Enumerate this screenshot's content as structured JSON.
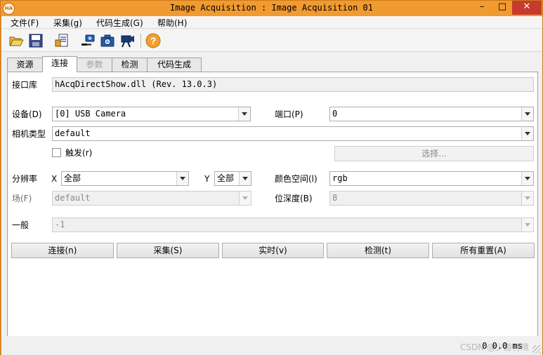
{
  "window": {
    "app_icon_text": "HA",
    "title": "Image Acquisition : Image Acquisition 01",
    "minimize": "–",
    "maximize": "□",
    "close": "✕"
  },
  "menu": [
    "文件(F)",
    "采集(g)",
    "代码生成(G)",
    "帮助(H)"
  ],
  "toolbar": {
    "icons": [
      "open-folder-icon",
      "save-icon",
      "generate-code-icon",
      "connect-camera-icon",
      "snap-camera-icon",
      "live-camera-icon",
      "help-icon"
    ]
  },
  "tabs": [
    {
      "label": "资源",
      "state": "normal"
    },
    {
      "label": "连接",
      "state": "active"
    },
    {
      "label": "参数",
      "state": "disabled"
    },
    {
      "label": "检测",
      "state": "normal"
    },
    {
      "label": "代码生成",
      "state": "normal"
    }
  ],
  "interface": {
    "label": "接口库",
    "value": "hAcqDirectShow.dll (Rev. 13.0.3)"
  },
  "device": {
    "label": "设备(D)",
    "value": "[0] USB Camera",
    "port_label": "端口(P)",
    "port_value": "0"
  },
  "camera_type": {
    "label": "相机类型",
    "value": "default"
  },
  "trigger": {
    "label": "触发(r)",
    "checked": false,
    "select_button": "选择..."
  },
  "resolution": {
    "label": "分辨率",
    "x_label": "X",
    "x_value": "全部",
    "y_label": "Y",
    "y_value": "全部",
    "colorspace_label": "颜色空间(l)",
    "colorspace_value": "rgb"
  },
  "field": {
    "label": "场(F)",
    "value": "default",
    "bitdepth_label": "位深度(B)",
    "bitdepth_value": "8"
  },
  "general": {
    "label": "一般",
    "value": "-1"
  },
  "actions": [
    "连接(n)",
    "采集(S)",
    "实时(v)",
    "检测(t)",
    "所有重置(A)"
  ],
  "status": {
    "text": "0   0.0 ms",
    "watermark": "CSDN @少游特境"
  },
  "colors": {
    "frame": "#f19a30",
    "close_button": "#c83b2c",
    "panel": "#ffffff"
  }
}
